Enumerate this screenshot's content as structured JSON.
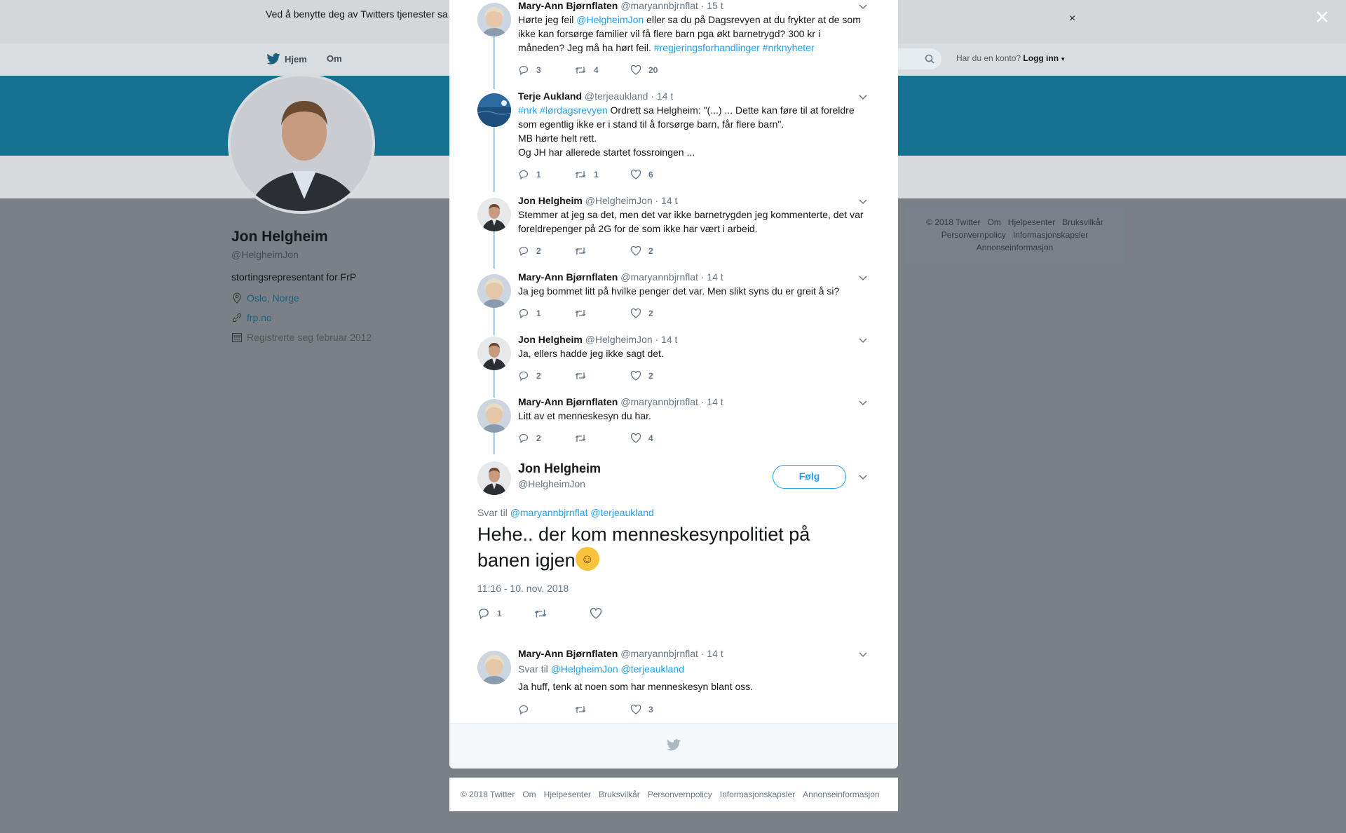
{
  "cookie": {
    "text": "Ved å benytte deg av Twitters tjenester sa… informasjonskapsler til bl.a. analyser, personalisering og annonser.",
    "close": "×"
  },
  "nav": {
    "home": "Hjem",
    "about": "Om",
    "login_prompt": "Har du en konto?",
    "login": "Logg inn"
  },
  "profile": {
    "name": "Jon Helgheim",
    "handle": "@HelgheimJon",
    "bio": "stortingsrepresentant for FrP",
    "location": "Oslo, Norge",
    "url": "frp.no",
    "joined": "Registrerte seg februar 2012"
  },
  "side_footer": [
    "© 2018 Twitter",
    "Om",
    "Hjelpesenter",
    "Bruksvilkår",
    "Personvernpolicy",
    "Informasjonskapsler",
    "Annonseinformasjon"
  ],
  "tweets": [
    {
      "name": "Mary-Ann Bjørnflaten",
      "handle": "@maryannbjrnflat",
      "time": "· 15 t",
      "text_a": "Hørte jeg feil ",
      "mention": "@HelgheimJon",
      "text_b": " eller sa du på Dagsrevyen at du frykter at de som ikke kan forsørge familier vil få flere barn pga økt barnetrygd? 300 kr i måneden? Jeg må ha hørt feil. ",
      "tags": "#regjeringsforhandlinger #nrknyheter",
      "replies": "3",
      "retweets": "4",
      "likes": "20"
    },
    {
      "name": "Terje Aukland",
      "handle": "@terjeaukland",
      "time": "· 14 t",
      "tags": "#nrk #lørdagsrevyen",
      "text_a": "  Ordrett sa Helgheim: \"(...) ... Dette kan føre til at foreldre som egentlig ikke er i stand til å forsørge barn, får flere barn\".",
      "line2": "MB hørte helt rett.",
      "line3": "Og JH har allerede startet fossroingen ...",
      "replies": "1",
      "retweets": "1",
      "likes": "6"
    },
    {
      "name": "Jon Helgheim",
      "handle": "@HelgheimJon",
      "time": "· 14 t",
      "text_a": "Stemmer at jeg sa det, men det var ikke barnetrygden jeg kommenterte, det var foreldrepenger på 2G for de som ikke har vært i arbeid.",
      "replies": "2",
      "retweets": "",
      "likes": "2"
    },
    {
      "name": "Mary-Ann Bjørnflaten",
      "handle": "@maryannbjrnflat",
      "time": "· 14 t",
      "text_a": "Ja jeg bommet litt på hvilke penger det var. Men slikt syns du er greit å si?",
      "replies": "1",
      "retweets": "",
      "likes": "2"
    },
    {
      "name": "Jon Helgheim",
      "handle": "@HelgheimJon",
      "time": "· 14 t",
      "text_a": "Ja, ellers hadde jeg ikke sagt det.",
      "replies": "2",
      "retweets": "",
      "likes": "2"
    },
    {
      "name": "Mary-Ann Bjørnflaten",
      "handle": "@maryannbjrnflat",
      "time": "· 14 t",
      "text_a": "Litt av et menneskesyn du har.",
      "replies": "2",
      "retweets": "",
      "likes": "4"
    }
  ],
  "main_tweet": {
    "name": "Jon Helgheim",
    "handle": "@HelgheimJon",
    "follow": "Følg",
    "reply_label": "Svar til",
    "reply_to": "@maryannbjrnflat @terjeaukland",
    "text": "Hehe.. der kom menneskesynpolitiet på banen igjen",
    "timestamp": "11:16 - 10. nov. 2018",
    "replies": "1"
  },
  "reply_tweet": {
    "name": "Mary-Ann Bjørnflaten",
    "handle": "@maryannbjrnflat",
    "time": "· 14 t",
    "reply_label": "Svar til",
    "reply_to": "@HelgheimJon @terjeaukland",
    "text": "Ja huff, tenk at noen som har menneskesyn blant oss.",
    "likes": "3"
  },
  "bottom_footer": [
    "© 2018 Twitter",
    "Om",
    "Hjelpesenter",
    "Bruksvilkår",
    "Personvernpolicy",
    "Informasjonskapsler",
    "Annonseinformasjon"
  ],
  "colors": {
    "link": "#1da1f2",
    "banner": "#15718f",
    "overlay": "#7a8086"
  }
}
